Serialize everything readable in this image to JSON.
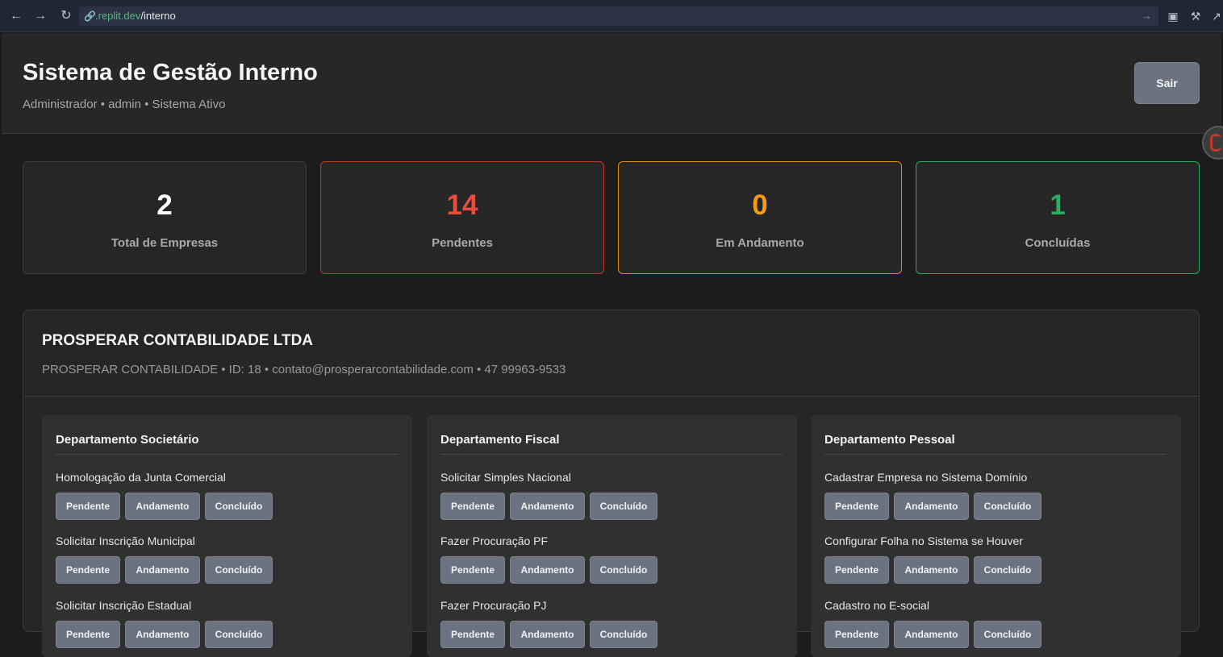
{
  "browser": {
    "url_domain": ".replit.dev",
    "url_path": "/interno"
  },
  "header": {
    "title": "Sistema de Gestão Interno",
    "subtitle": "Administrador • admin • Sistema Ativo",
    "logout_label": "Sair"
  },
  "stats": [
    {
      "value": "2",
      "label": "Total de Empresas",
      "color": "#ffffff",
      "border": "#3c3c3c"
    },
    {
      "value": "14",
      "label": "Pendentes",
      "color": "#e74c3c",
      "border": "#c0392b"
    },
    {
      "value": "0",
      "label": "Em Andamento",
      "color": "#f39c12",
      "border": "#e08e0b"
    },
    {
      "value": "1",
      "label": "Concluídas",
      "color": "#27ae60",
      "border": "#27ae60"
    }
  ],
  "company": {
    "name": "PROSPERAR CONTABILIDADE LTDA",
    "info": "PROSPERAR CONTABILIDADE • ID: 18 • contato@prosperarcontabilidade.com • 47 99963-9533"
  },
  "status_buttons": {
    "pending": "Pendente",
    "in_progress": "Andamento",
    "done": "Concluído"
  },
  "departments": [
    {
      "title": "Departamento Societário",
      "tasks": [
        "Homologação da Junta Comercial",
        "Solicitar Inscrição Municipal",
        "Solicitar Inscrição Estadual"
      ]
    },
    {
      "title": "Departamento Fiscal",
      "tasks": [
        "Solicitar Simples Nacional",
        "Fazer Procuração PF",
        "Fazer Procuração PJ"
      ]
    },
    {
      "title": "Departamento Pessoal",
      "tasks": [
        "Cadastrar Empresa no Sistema Domínio",
        "Configurar Folha no Sistema se Houver",
        "Cadastro no E-social"
      ]
    }
  ]
}
